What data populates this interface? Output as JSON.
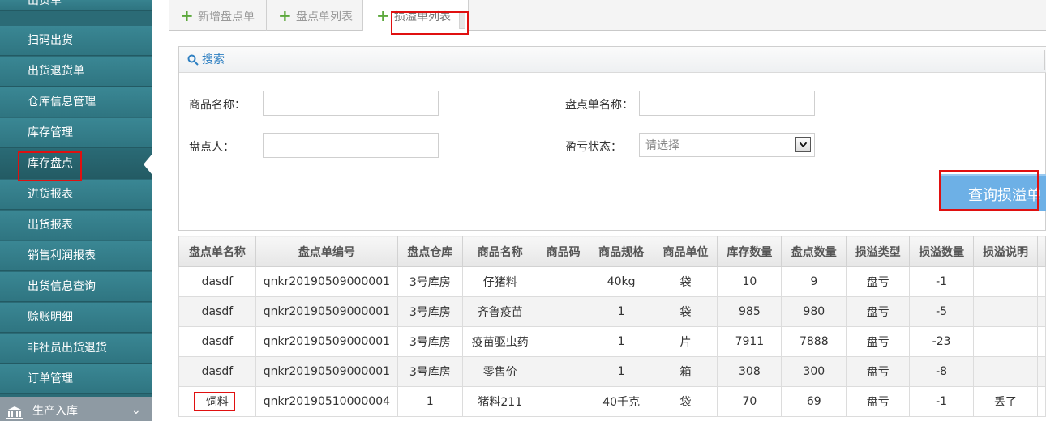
{
  "sidebar": {
    "items": [
      {
        "label": "出货单"
      },
      {
        "label": "扫码出货"
      },
      {
        "label": "出货退货单"
      },
      {
        "label": "仓库信息管理"
      },
      {
        "label": "库存管理"
      },
      {
        "label": "库存盘点"
      },
      {
        "label": "进货报表"
      },
      {
        "label": "出货报表"
      },
      {
        "label": "销售利润报表"
      },
      {
        "label": "出货信息查询"
      },
      {
        "label": "赊账明细"
      },
      {
        "label": "非社员出货退货"
      },
      {
        "label": "订单管理"
      }
    ],
    "active_index": 5,
    "group": {
      "label": "生产入库"
    }
  },
  "tabs": [
    {
      "label": "新增盘点单"
    },
    {
      "label": "盘点单列表"
    },
    {
      "label": "损溢单列表"
    }
  ],
  "active_tab": 2,
  "search": {
    "header": "搜索",
    "product_name_label": "商品名称：",
    "product_name_value": "",
    "order_name_label": "盘点单名称：",
    "order_name_value": "",
    "counter_label": "盘点人：",
    "counter_value": "",
    "status_label": "盈亏状态：",
    "status_selected": "请选择",
    "query_button": "查询损溢单"
  },
  "table": {
    "columns": [
      "盘点单名称",
      "盘点单编号",
      "盘点仓库",
      "商品名称",
      "商品码",
      "商品规格",
      "商品单位",
      "库存数量",
      "盘点数量",
      "损溢类型",
      "损溢数量",
      "损溢说明"
    ],
    "rows": [
      [
        "dasdf",
        "qnkr20190509000001",
        "3号库房",
        "仔猪料",
        "",
        "40kg",
        "袋",
        "10",
        "9",
        "盘亏",
        "-1",
        ""
      ],
      [
        "dasdf",
        "qnkr20190509000001",
        "3号库房",
        "齐鲁疫苗",
        "",
        "1",
        "袋",
        "985",
        "980",
        "盘亏",
        "-5",
        ""
      ],
      [
        "dasdf",
        "qnkr20190509000001",
        "3号库房",
        "疫苗驱虫药",
        "",
        "1",
        "片",
        "7911",
        "7888",
        "盘亏",
        "-23",
        ""
      ],
      [
        "dasdf",
        "qnkr20190509000001",
        "3号库房",
        "零售价",
        "",
        "1",
        "箱",
        "308",
        "300",
        "盘亏",
        "-8",
        ""
      ],
      [
        "饲料",
        "qnkr20190510000004",
        "1",
        "猪料211",
        "",
        "40千克",
        "袋",
        "70",
        "69",
        "盘亏",
        "-1",
        "丢了"
      ]
    ]
  }
}
